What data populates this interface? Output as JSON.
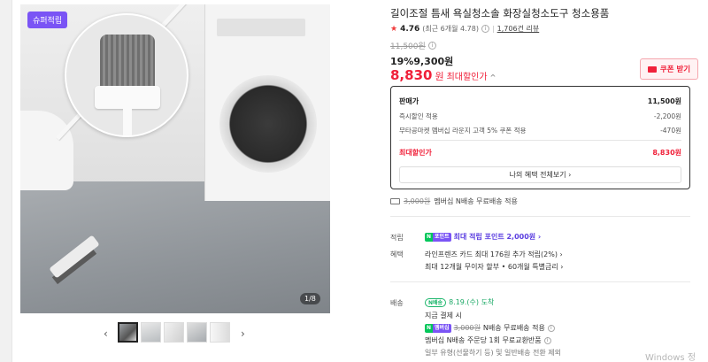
{
  "product": {
    "title": "길이조절 틈새 욕실청소솔 화장실청소도구 청소용품",
    "rating": {
      "score": "4.76",
      "recent": "(최근 6개월 4.78)",
      "reviews": "1,706건 리뷰"
    },
    "price": {
      "original": "11,500원",
      "discount": "19%9,300원",
      "final_amount": "8,830",
      "final_won": "원",
      "final_label": "최대할인가",
      "final_chevron": "^"
    },
    "coupon_button": "쿠폰 받기",
    "super_badge": "슈퍼적립",
    "image_pager": "1/8"
  },
  "price_box": {
    "header_label": "판매가",
    "header_value": "11,500원",
    "rows": [
      {
        "label": "즉시할인 적용",
        "value": "-2,200원"
      },
      {
        "label": "무타공마켓 멤버십 라운지 고객 5% 쿠폰 적용",
        "value": "-470원"
      }
    ],
    "max_label": "최대할인가",
    "max_value": "8,830원",
    "benefit_button": "나의 혜택 전체보기 ›"
  },
  "shipping_summary": {
    "strike": "3,000원",
    "text": "멤버십 N배송 무료배송 적용"
  },
  "points": {
    "label": "적립",
    "badge_n": "N",
    "badge_p": "포인트",
    "text": "최대 적립 포인트 2,000원 ›"
  },
  "benefits": {
    "label": "혜택",
    "line1": "라인프렌즈 카드 최대 176원 추가 적립(2%) ›",
    "line2": "최대 12개월 무이자 할부 • 60개월 특별금리 ›"
  },
  "delivery": {
    "label": "배송",
    "pill": "N배송",
    "date": "8.19.(수) 도착",
    "line2": "지금 결제 시",
    "line3_badge": "멤버십",
    "line3_strike": "3,000원",
    "line3_text": "N배송 무료배송 적용",
    "line4": "멤버십 N배송 주문당 1회 무료교환반품",
    "line5": "일부 유형(선물하기 등) 및 일반배송 전환 제외"
  },
  "watermark": "Windows 정"
}
